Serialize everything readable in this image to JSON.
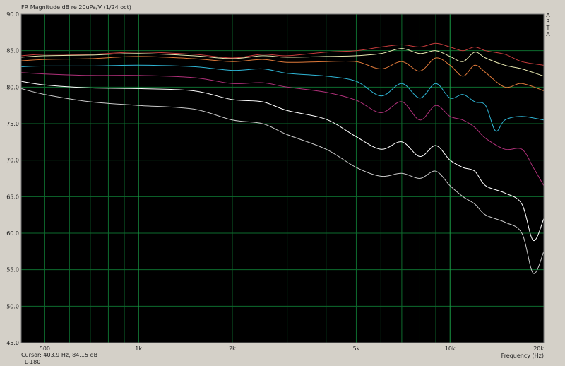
{
  "header": {
    "title": "FR Magnitude dB re 20uPa/V (1/24 oct)",
    "vertical_label": [
      "A",
      "R",
      "T",
      "A"
    ]
  },
  "status": {
    "cursor": "Cursor: 403.9 Hz, 84.15 dB",
    "name": "TL-180"
  },
  "colors": {
    "plot_background": "#000000",
    "grid": "#0d6b2e",
    "window_background": "#d4d0c8"
  },
  "chart_data": {
    "type": "line",
    "title": "FR Magnitude dB re 20uPa/V (1/24 oct)",
    "xlabel": "Frequency (Hz)",
    "ylabel": "",
    "xscale": "log",
    "xlim": [
      420,
      20000
    ],
    "ylim": [
      45,
      90
    ],
    "yticks": [
      "90.0",
      "85.0",
      "80.0",
      "75.0",
      "70.0",
      "65.0",
      "60.0",
      "55.0",
      "50.0",
      "45.0"
    ],
    "xtick_labels": [
      {
        "value": 500,
        "label": "500"
      },
      {
        "value": 1000,
        "label": "1k"
      },
      {
        "value": 2000,
        "label": "2k"
      },
      {
        "value": 5000,
        "label": "5k"
      },
      {
        "value": 10000,
        "label": "10k"
      },
      {
        "value": 20000,
        "label": "20k"
      }
    ],
    "grid": true,
    "legend": "none",
    "series": [
      {
        "color": "#c83c3c",
        "points": [
          [
            420,
            84.3
          ],
          [
            500,
            84.5
          ],
          [
            700,
            84.5
          ],
          [
            1000,
            84.8
          ],
          [
            1500,
            84.5
          ],
          [
            2000,
            84.0
          ],
          [
            2500,
            84.5
          ],
          [
            3000,
            84.3
          ],
          [
            4000,
            84.8
          ],
          [
            5000,
            85.0
          ],
          [
            6000,
            85.5
          ],
          [
            7000,
            85.8
          ],
          [
            8000,
            85.5
          ],
          [
            9000,
            86.0
          ],
          [
            10000,
            85.5
          ],
          [
            11000,
            85.0
          ],
          [
            12000,
            85.5
          ],
          [
            13000,
            85.0
          ],
          [
            15000,
            84.5
          ],
          [
            17000,
            83.5
          ],
          [
            20000,
            83.0
          ]
        ]
      },
      {
        "color": "#e8e8b0",
        "points": [
          [
            420,
            84.1
          ],
          [
            500,
            84.3
          ],
          [
            700,
            84.4
          ],
          [
            1000,
            84.6
          ],
          [
            1500,
            84.3
          ],
          [
            2000,
            83.9
          ],
          [
            2500,
            84.3
          ],
          [
            3000,
            84.1
          ],
          [
            4000,
            84.2
          ],
          [
            5000,
            84.3
          ],
          [
            6000,
            84.6
          ],
          [
            7000,
            85.3
          ],
          [
            8000,
            84.6
          ],
          [
            9000,
            85.0
          ],
          [
            10000,
            84.2
          ],
          [
            11000,
            83.5
          ],
          [
            12000,
            84.8
          ],
          [
            13000,
            84.0
          ],
          [
            15000,
            83.0
          ],
          [
            17000,
            82.5
          ],
          [
            20000,
            81.5
          ]
        ]
      },
      {
        "color": "#e07a3a",
        "points": [
          [
            420,
            83.6
          ],
          [
            500,
            83.8
          ],
          [
            700,
            83.9
          ],
          [
            1000,
            84.2
          ],
          [
            1500,
            83.9
          ],
          [
            2000,
            83.5
          ],
          [
            2500,
            83.8
          ],
          [
            3000,
            83.4
          ],
          [
            4000,
            83.5
          ],
          [
            5000,
            83.5
          ],
          [
            6000,
            82.5
          ],
          [
            7000,
            83.5
          ],
          [
            8000,
            82.2
          ],
          [
            9000,
            84.0
          ],
          [
            10000,
            83.0
          ],
          [
            11000,
            81.5
          ],
          [
            12000,
            83.0
          ],
          [
            13000,
            82.0
          ],
          [
            15000,
            80.0
          ],
          [
            17000,
            80.5
          ],
          [
            20000,
            79.5
          ]
        ]
      },
      {
        "color": "#2fb6d6",
        "points": [
          [
            420,
            82.8
          ],
          [
            500,
            82.9
          ],
          [
            700,
            82.9
          ],
          [
            1000,
            83.0
          ],
          [
            1500,
            82.8
          ],
          [
            2000,
            82.3
          ],
          [
            2500,
            82.5
          ],
          [
            3000,
            81.9
          ],
          [
            4000,
            81.5
          ],
          [
            5000,
            80.8
          ],
          [
            6000,
            78.8
          ],
          [
            7000,
            80.5
          ],
          [
            8000,
            78.5
          ],
          [
            9000,
            80.5
          ],
          [
            10000,
            78.5
          ],
          [
            11000,
            79.0
          ],
          [
            12000,
            78.0
          ],
          [
            13000,
            77.5
          ],
          [
            14000,
            74.0
          ],
          [
            15000,
            75.5
          ],
          [
            17000,
            76.0
          ],
          [
            20000,
            75.5
          ]
        ]
      },
      {
        "color": "#b0307a",
        "points": [
          [
            420,
            82.0
          ],
          [
            500,
            81.8
          ],
          [
            700,
            81.6
          ],
          [
            1000,
            81.6
          ],
          [
            1500,
            81.3
          ],
          [
            2000,
            80.5
          ],
          [
            2500,
            80.6
          ],
          [
            3000,
            80.0
          ],
          [
            4000,
            79.3
          ],
          [
            5000,
            78.2
          ],
          [
            6000,
            76.5
          ],
          [
            7000,
            78.0
          ],
          [
            8000,
            75.5
          ],
          [
            9000,
            77.5
          ],
          [
            10000,
            76.0
          ],
          [
            11000,
            75.5
          ],
          [
            12000,
            74.5
          ],
          [
            13000,
            73.0
          ],
          [
            15000,
            71.5
          ],
          [
            17000,
            71.5
          ],
          [
            18500,
            69.0
          ],
          [
            20000,
            66.5
          ]
        ]
      },
      {
        "color": "#ffffff",
        "points": [
          [
            420,
            80.8
          ],
          [
            500,
            80.3
          ],
          [
            700,
            79.9
          ],
          [
            1000,
            79.8
          ],
          [
            1500,
            79.5
          ],
          [
            2000,
            78.3
          ],
          [
            2500,
            78.0
          ],
          [
            3000,
            76.8
          ],
          [
            4000,
            75.6
          ],
          [
            5000,
            73.2
          ],
          [
            6000,
            71.5
          ],
          [
            7000,
            72.5
          ],
          [
            8000,
            70.5
          ],
          [
            9000,
            72.0
          ],
          [
            10000,
            70.0
          ],
          [
            11000,
            69.0
          ],
          [
            12000,
            68.5
          ],
          [
            13000,
            66.5
          ],
          [
            15000,
            65.5
          ],
          [
            17000,
            64.0
          ],
          [
            18500,
            59.0
          ],
          [
            20000,
            62.0
          ]
        ]
      },
      {
        "color": "#c8c8c8",
        "points": [
          [
            420,
            79.8
          ],
          [
            500,
            79.0
          ],
          [
            700,
            78.0
          ],
          [
            1000,
            77.5
          ],
          [
            1500,
            77.0
          ],
          [
            2000,
            75.5
          ],
          [
            2500,
            75.0
          ],
          [
            3000,
            73.5
          ],
          [
            4000,
            71.5
          ],
          [
            5000,
            69.0
          ],
          [
            6000,
            67.8
          ],
          [
            7000,
            68.2
          ],
          [
            8000,
            67.5
          ],
          [
            9000,
            68.5
          ],
          [
            10000,
            66.5
          ],
          [
            11000,
            65.0
          ],
          [
            12000,
            64.0
          ],
          [
            13000,
            62.5
          ],
          [
            15000,
            61.5
          ],
          [
            17000,
            60.0
          ],
          [
            18500,
            54.5
          ],
          [
            20000,
            57.5
          ]
        ]
      }
    ]
  }
}
